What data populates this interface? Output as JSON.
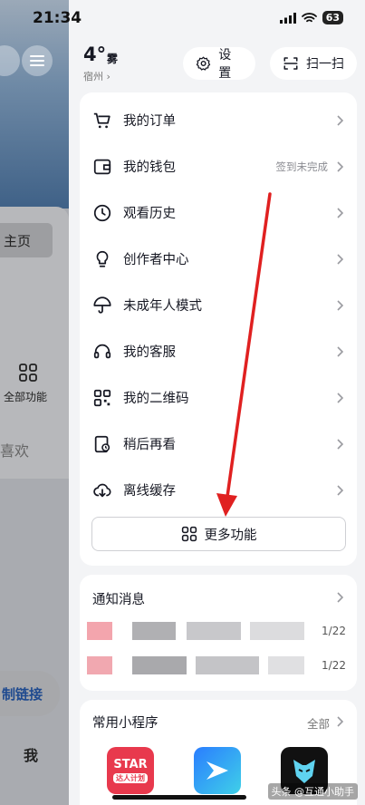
{
  "status_bar": {
    "time": "21:34",
    "battery": "63"
  },
  "background_page": {
    "home_tab": "主页",
    "all_functions": "全部功能",
    "likes": "喜欢",
    "copy_link": "制链接",
    "me": "我"
  },
  "weather": {
    "temp": "4°",
    "condition": "雾",
    "city": "宿州 ›"
  },
  "header": {
    "settings_label": "设置",
    "scan_label": "扫一扫"
  },
  "menu": {
    "items": [
      {
        "label": "我的订单",
        "icon": "cart-icon",
        "hint": ""
      },
      {
        "label": "我的钱包",
        "icon": "wallet-icon",
        "hint": "签到未完成"
      },
      {
        "label": "观看历史",
        "icon": "clock-icon",
        "hint": ""
      },
      {
        "label": "创作者中心",
        "icon": "lightbulb-icon",
        "hint": ""
      },
      {
        "label": "未成年人模式",
        "icon": "umbrella-icon",
        "hint": ""
      },
      {
        "label": "我的客服",
        "icon": "headset-icon",
        "hint": ""
      },
      {
        "label": "我的二维码",
        "icon": "qrcode-icon",
        "hint": ""
      },
      {
        "label": "稍后再看",
        "icon": "watch-later-icon",
        "hint": ""
      },
      {
        "label": "离线缓存",
        "icon": "cloud-download-icon",
        "hint": ""
      }
    ],
    "more_label": "更多功能"
  },
  "notifications": {
    "title": "通知消息",
    "dates": [
      "1/22",
      "1/22"
    ]
  },
  "mini_programs": {
    "title": "常用小程序",
    "all_label": "全部",
    "apps": [
      {
        "badge": "STAR",
        "sub": "达人计划"
      }
    ]
  },
  "watermark": "头条 @互通小助手",
  "colors": {
    "arrow": "#e02020",
    "card": "#ffffff",
    "page": "#f3f4f6"
  }
}
